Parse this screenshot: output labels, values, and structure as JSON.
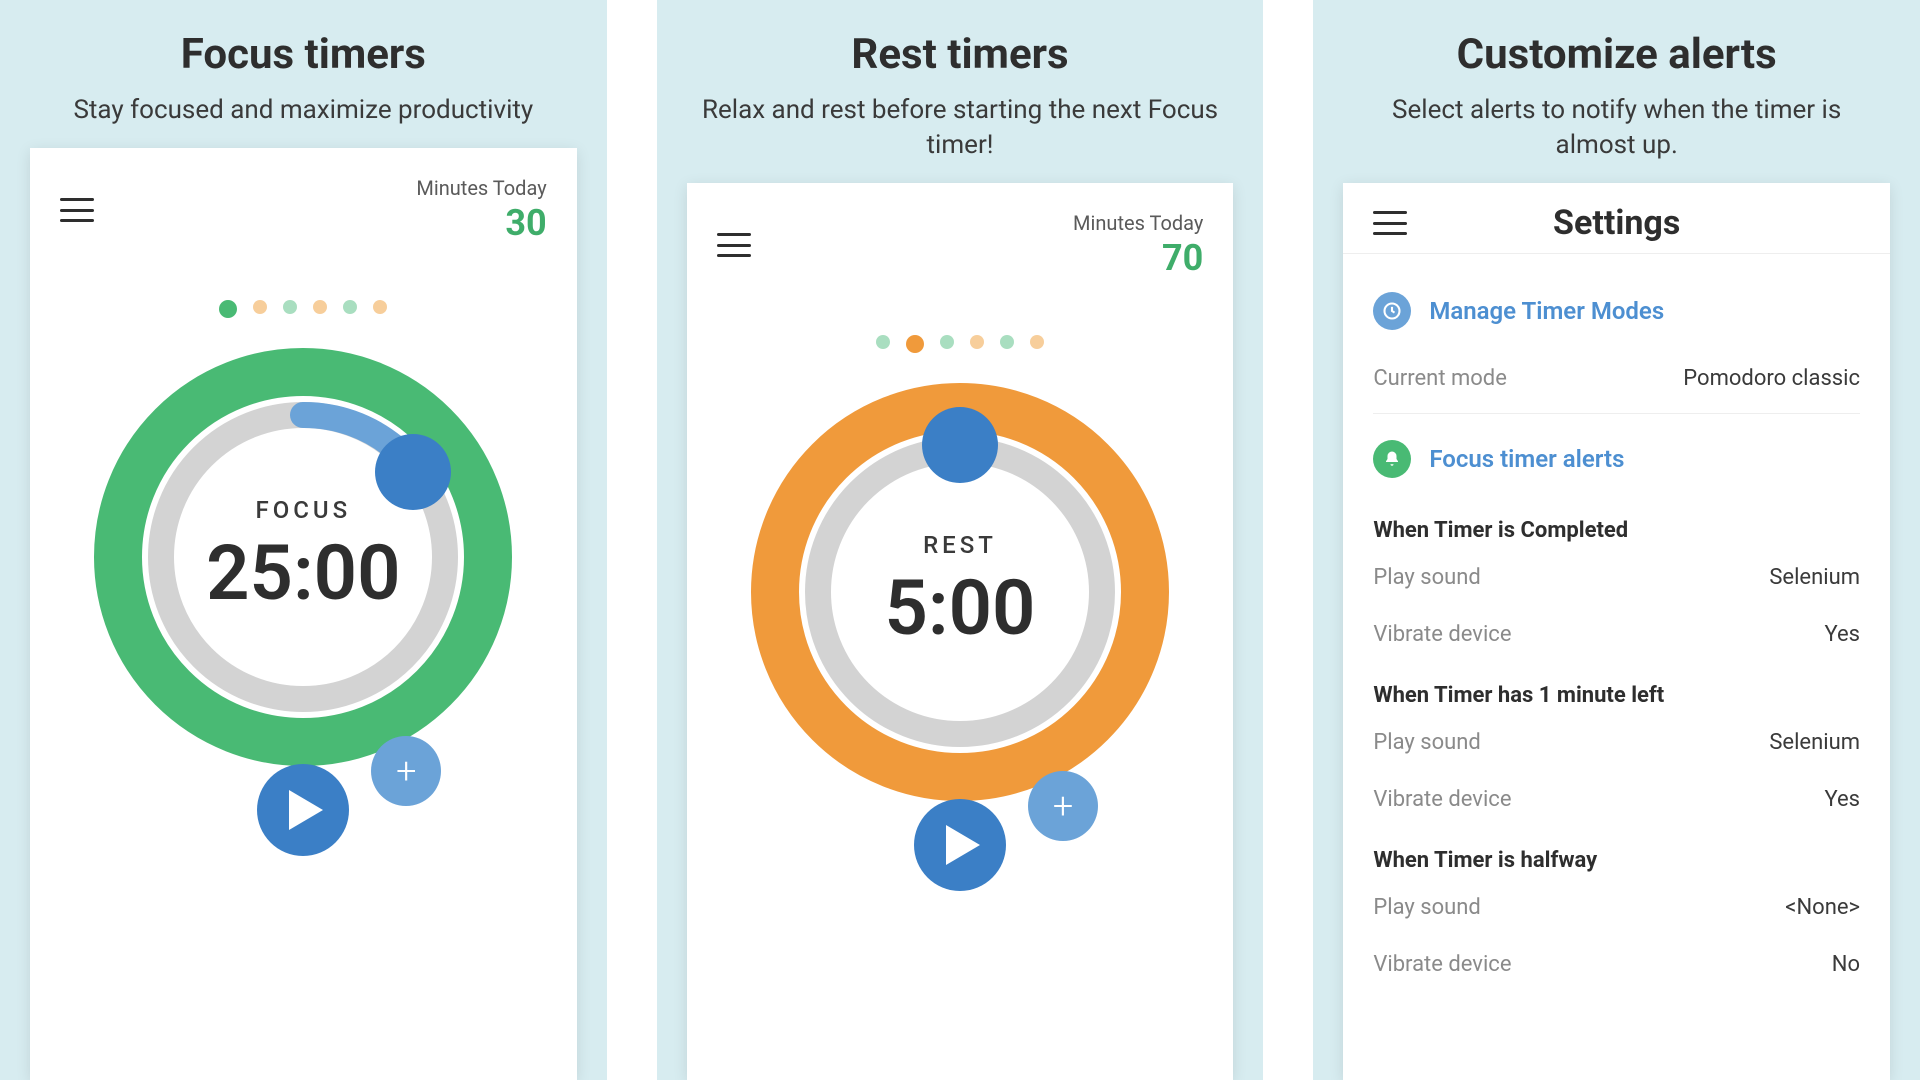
{
  "panels": [
    {
      "title": "Focus timers",
      "subtitle": "Stay focused and maximize productivity",
      "minutes_label": "Minutes Today",
      "minutes_value": "30",
      "ring": {
        "label": "FOCUS",
        "time": "25:00",
        "outer_color": "#49ba74",
        "progress_color": "#6ba3d8",
        "progress_fraction": 0.1,
        "handle_angle_deg": 40
      },
      "dots_active_index": 0
    },
    {
      "title": "Rest timers",
      "subtitle": "Relax and rest before starting the next Focus timer!",
      "minutes_label": "Minutes Today",
      "minutes_value": "70",
      "ring": {
        "label": "REST",
        "time": "5:00",
        "outer_color": "#f09a3b",
        "progress_color": "#3b7fc6",
        "progress_fraction": 0.0,
        "handle_angle_deg": 0
      },
      "dots_active_index": 1
    },
    {
      "title": "Customize alerts",
      "subtitle": "Select alerts to notify when the timer is almost up.",
      "settings_title": "Settings",
      "settings": {
        "manage_modes_label": "Manage Timer Modes",
        "current_mode_label": "Current mode",
        "current_mode_value": "Pomodoro classic",
        "focus_alerts_label": "Focus timer alerts",
        "sections": [
          {
            "heading": "When Timer is Completed",
            "play_sound_label": "Play sound",
            "play_sound_value": "Selenium",
            "vibrate_label": "Vibrate device",
            "vibrate_value": "Yes"
          },
          {
            "heading": "When Timer has 1 minute left",
            "play_sound_label": "Play sound",
            "play_sound_value": "Selenium",
            "vibrate_label": "Vibrate device",
            "vibrate_value": "Yes"
          },
          {
            "heading": "When Timer is halfway",
            "play_sound_label": "Play sound",
            "play_sound_value": "<None>",
            "vibrate_label": "Vibrate device",
            "vibrate_value": "No"
          }
        ]
      }
    }
  ]
}
